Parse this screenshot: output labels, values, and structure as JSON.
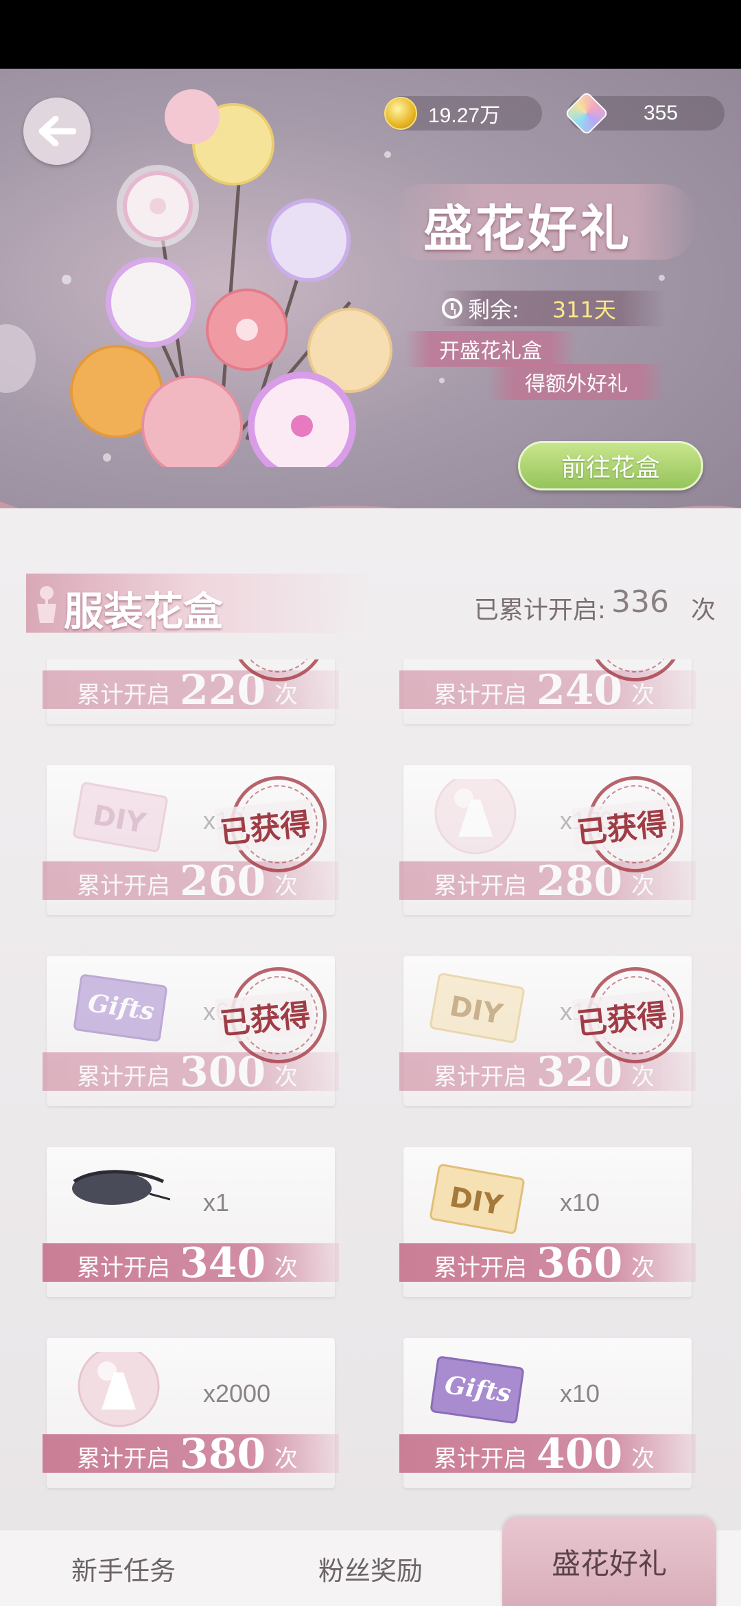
{
  "header": {
    "coins": "19.27万",
    "gems": "355",
    "event_title": "盛花好礼",
    "remaining_label": "剩余:",
    "remaining_days": "311天",
    "promo_line1": "开盛花礼盒",
    "promo_line2": "得额外好礼",
    "goto_button": "前往花盒"
  },
  "section": {
    "title": "服装花盒",
    "count_label": "已累计开启:",
    "count_value": "336",
    "count_unit": "次"
  },
  "milestone_label": "累计开启",
  "milestone_unit": "次",
  "stamp_text": "已获得",
  "rewards": [
    {
      "threshold": "220",
      "qty": "",
      "item": "pink-card-icon",
      "obtained": true
    },
    {
      "threshold": "240",
      "qty": "",
      "item": "brown-accessory-icon",
      "obtained": true
    },
    {
      "threshold": "260",
      "qty": "x10",
      "item": "diy-card-pink-icon",
      "obtained": true
    },
    {
      "threshold": "280",
      "qty": "x1500",
      "item": "dress-orb-icon",
      "obtained": true
    },
    {
      "threshold": "300",
      "qty": "x6",
      "item": "gift-card-purple-icon",
      "obtained": true
    },
    {
      "threshold": "320",
      "qty": "x10",
      "item": "diy-card-gold-icon",
      "obtained": true
    },
    {
      "threshold": "340",
      "qty": "x1",
      "item": "sunglasses-icon",
      "obtained": false
    },
    {
      "threshold": "360",
      "qty": "x10",
      "item": "diy-card-gold-icon",
      "obtained": false
    },
    {
      "threshold": "380",
      "qty": "x2000",
      "item": "dress-orb-icon",
      "obtained": false
    },
    {
      "threshold": "400",
      "qty": "x10",
      "item": "gift-card-purple-icon",
      "obtained": false
    }
  ],
  "tabs": [
    {
      "label": "新手任务",
      "active": false
    },
    {
      "label": "粉丝奖励",
      "active": false
    },
    {
      "label": "盛花好礼",
      "active": true
    }
  ]
}
